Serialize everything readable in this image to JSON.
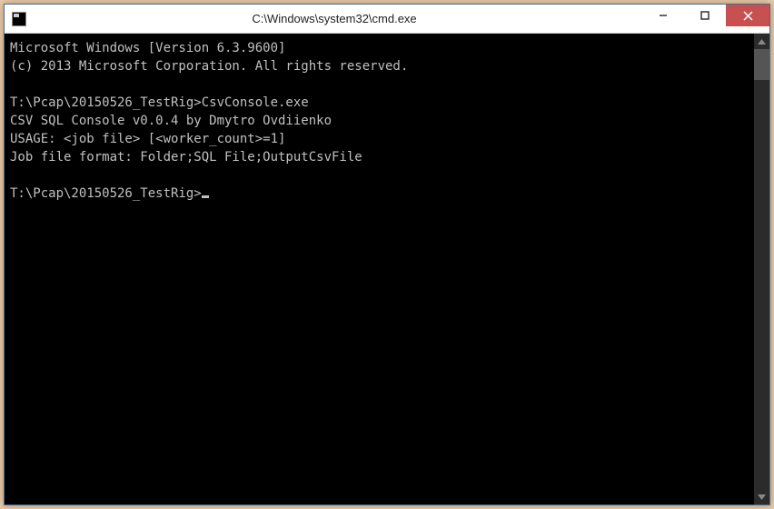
{
  "window": {
    "title": "C:\\Windows\\system32\\cmd.exe"
  },
  "console": {
    "lines": [
      "Microsoft Windows [Version 6.3.9600]",
      "(c) 2013 Microsoft Corporation. All rights reserved.",
      "",
      "T:\\Pcap\\20150526_TestRig>CsvConsole.exe",
      "CSV SQL Console v0.0.4 by Dmytro Ovdiienko",
      "USAGE: <job file> [<worker_count>=1]",
      "Job file format: Folder;SQL File;OutputCsvFile",
      "",
      "T:\\Pcap\\20150526_TestRig>"
    ]
  }
}
